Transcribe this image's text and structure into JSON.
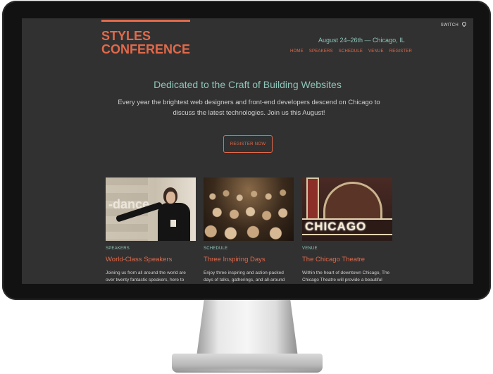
{
  "site": {
    "logo_line1": "STYLES",
    "logo_line2": "CONFERENCE",
    "switch_label": "SWITCH",
    "dates": "August 24–26th — Chicago, IL",
    "nav": [
      "HOME",
      "SPEAKERS",
      "SCHEDULE",
      "VENUE",
      "REGISTER"
    ]
  },
  "hero": {
    "headline": "Dedicated to the Craft of Building Websites",
    "intro_line1": "Every year the brightest web designers and front-end developers descend on Chicago to",
    "intro_line2": "discuss the latest technologies. Join us this August!",
    "register_label": "REGISTER NOW"
  },
  "cards": [
    {
      "tag": "SPEAKERS",
      "title": "World-Class Speakers",
      "desc": "Joining us from all around the world are over twenty fantastic speakers, here to",
      "image_text": "-dance"
    },
    {
      "tag": "SCHEDULE",
      "title": "Three Inspiring Days",
      "desc": "Enjoy three inspiring and action-packed days of talks, gatherings, and all-around"
    },
    {
      "tag": "VENUE",
      "title": "The Chicago Theatre",
      "desc": "Within the heart of downtown Chicago, The Chicago Theatre will provide a beautiful",
      "image_text": "CHICAGO"
    }
  ],
  "colors": {
    "accent": "#e3694a",
    "teal": "#8ec5b9",
    "screen_bg": "#313131"
  },
  "icons": {
    "switch": "map-pin-icon"
  }
}
